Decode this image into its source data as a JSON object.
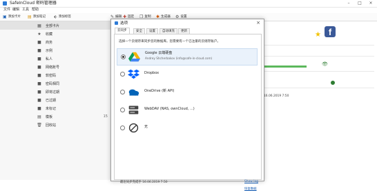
{
  "window": {
    "title": "SafeInCloud 密码管理器"
  },
  "menu": {
    "items": [
      "文件",
      "编辑",
      "工具",
      "帮助"
    ]
  },
  "toolbar": {
    "add_card": "添加卡片",
    "add_note": "添加笔记",
    "add_label": "添加标签",
    "edit": "编辑",
    "pin": "固定",
    "copy": "复制",
    "generate": "生成器",
    "settings": "设置"
  },
  "sidebar": {
    "items": [
      {
        "label": "全部卡片",
        "count": "",
        "icon": "cards-icon"
      },
      {
        "label": "收藏",
        "count": "",
        "icon": "star-icon"
      },
      {
        "label": "商务",
        "count": "",
        "icon": "label-icon"
      },
      {
        "label": "示例",
        "count": "",
        "icon": "label-icon"
      },
      {
        "label": "私人",
        "count": "",
        "icon": "label-icon"
      },
      {
        "label": "网络账号",
        "count": "",
        "icon": "label-icon"
      },
      {
        "label": "软密码",
        "count": "",
        "icon": "label-icon"
      },
      {
        "label": "密码相同",
        "count": "",
        "icon": "label-icon"
      },
      {
        "label": "即将过期",
        "count": "",
        "icon": "label-icon"
      },
      {
        "label": "已过期",
        "count": "",
        "icon": "label-icon"
      },
      {
        "label": "未标记",
        "count": "",
        "icon": "label-icon"
      },
      {
        "label": "模板",
        "count": "15",
        "icon": "template-icon"
      },
      {
        "label": "回收站",
        "count": "",
        "icon": "trash-icon"
      }
    ]
  },
  "details": {
    "timestamp": "16.06.2019 7:50"
  },
  "dialog": {
    "title": "选项",
    "tabs": [
      "云同步",
      "安全",
      "设置",
      "自动填充",
      "更新"
    ],
    "active_tab": 0,
    "instruction": "选择一个云储存来同步您的数据库。您需要有一个已注册的云储存账户。",
    "options": [
      {
        "label": "Google 云端硬盘",
        "sub": "Andrey Shcherbakov (info@safe-in-cloud.com)",
        "selected": true,
        "icon": "google-drive-icon"
      },
      {
        "label": "Dropbox",
        "sub": "",
        "selected": false,
        "icon": "dropbox-icon"
      },
      {
        "label": "OneDrive (新 API)",
        "sub": "",
        "selected": false,
        "icon": "onedrive-icon"
      },
      {
        "label": "WebDAV (NAS, ownCloud, ...)",
        "sub": "",
        "selected": false,
        "icon": "webdav-icon"
      },
      {
        "label": "无",
        "sub": "",
        "selected": false,
        "icon": "none-icon"
      }
    ],
    "last_sync": "最近同步完成于 16.06.2019 7:50",
    "show_log": "Show log",
    "restore_data": "恢复数据"
  },
  "colors": {
    "accent": "#1a5fb4",
    "selected_row": "#eaf2fb",
    "facebook": "#3b5998",
    "star": "#f2c200",
    "google_blue": "#4285f4",
    "google_green": "#0f9d58",
    "google_yellow": "#f4b400",
    "dropbox": "#0061fe",
    "onedrive": "#0364b8"
  }
}
